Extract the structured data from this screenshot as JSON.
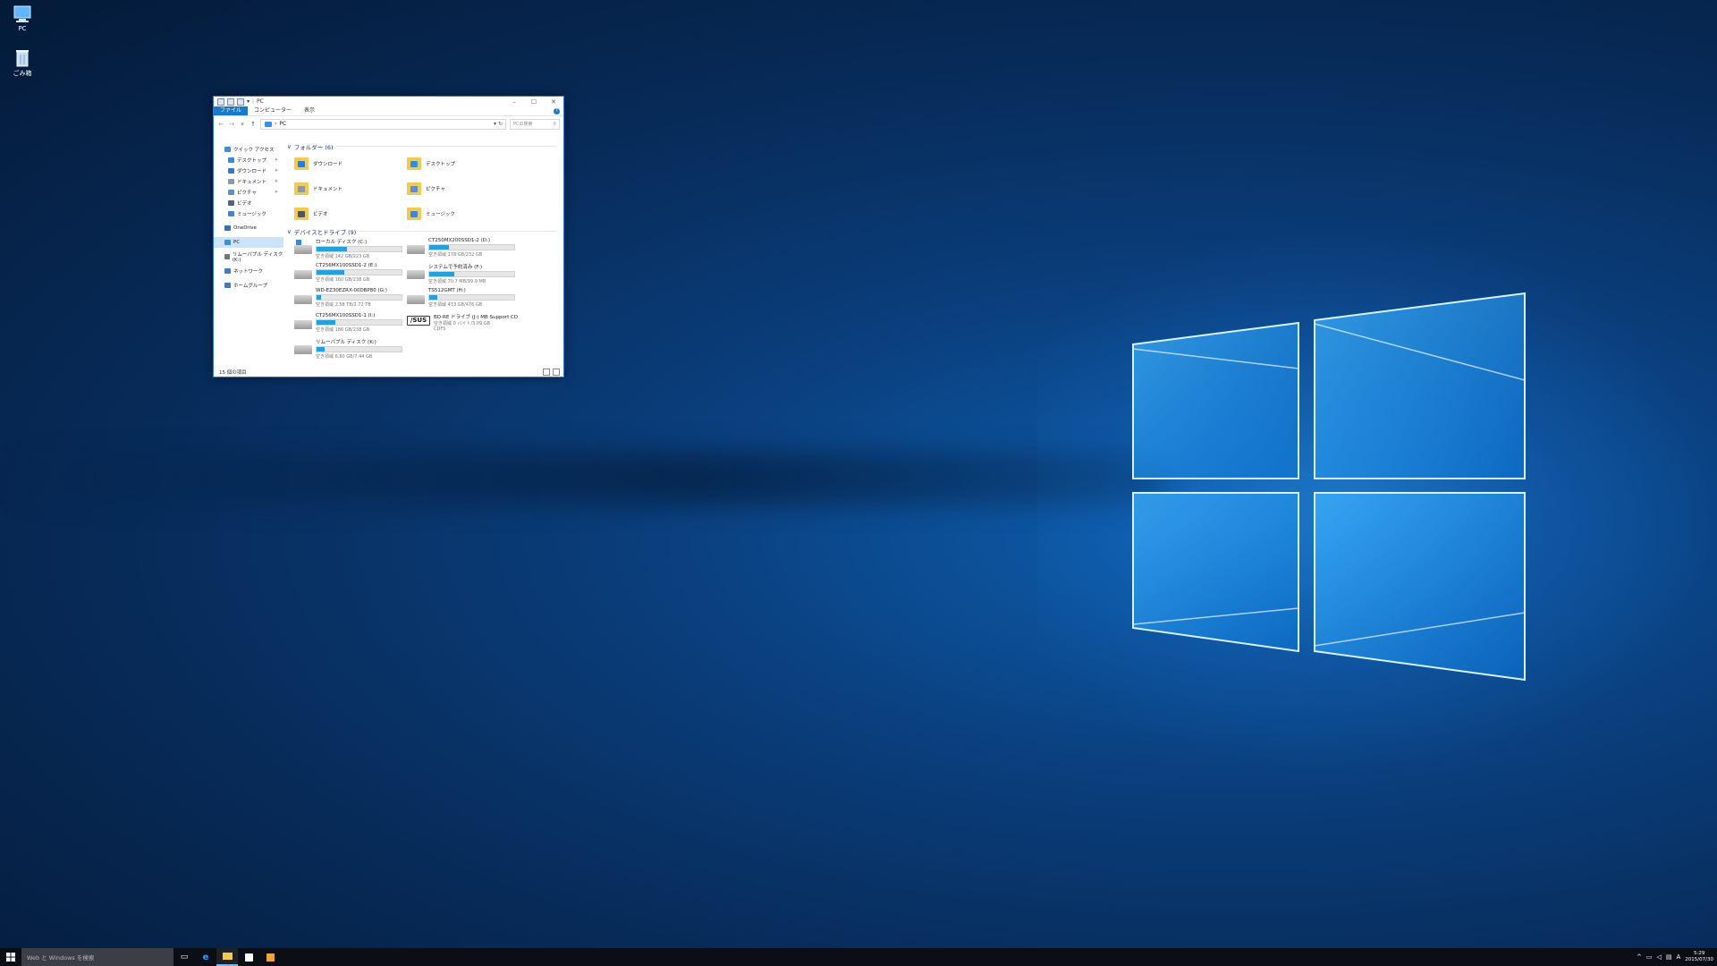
{
  "desktop": {
    "icons": [
      {
        "label": "PC"
      },
      {
        "label": "ごみ箱"
      }
    ]
  },
  "window": {
    "title": "PC",
    "ribbon_tabs": [
      "ファイル",
      "コンピューター",
      "表示"
    ],
    "address": "PC",
    "search_placeholder": "PCの検索",
    "nav": [
      {
        "label": "クイック アクセス",
        "pinned": false,
        "level": 0,
        "color": "#3a8ee6"
      },
      {
        "label": "デスクトップ",
        "pinned": true,
        "level": 1,
        "color": "#2f8fde"
      },
      {
        "label": "ダウンロード",
        "pinned": true,
        "level": 1,
        "color": "#2c7cd2"
      },
      {
        "label": "ドキュメント",
        "pinned": true,
        "level": 1,
        "color": "#8a9aa8"
      },
      {
        "label": "ピクチャ",
        "pinned": true,
        "level": 1,
        "color": "#5d8fc9"
      },
      {
        "label": "ビデオ",
        "pinned": false,
        "level": 1,
        "color": "#5a6470"
      },
      {
        "label": "ミュージック",
        "pinned": false,
        "level": 1,
        "color": "#3e86d6"
      },
      {
        "label": "OneDrive",
        "pinned": false,
        "level": 0,
        "color": "#2a73c9"
      },
      {
        "label": "PC",
        "pinned": false,
        "level": 0,
        "color": "#3c8ede",
        "selected": true
      },
      {
        "label": "リムーバブル ディスク (K:)",
        "pinned": false,
        "level": 0,
        "color": "#777777"
      },
      {
        "label": "ネットワーク",
        "pinned": false,
        "level": 0,
        "color": "#3c7fcf"
      },
      {
        "label": "ホームグループ",
        "pinned": false,
        "level": 0,
        "color": "#3f7ac2"
      }
    ],
    "folders_header": "フォルダー (6)",
    "folders": [
      {
        "label": "ダウンロード",
        "badge": "#2c7cd2"
      },
      {
        "label": "デスクトップ",
        "badge": "#2f8fde"
      },
      {
        "label": "ドキュメント",
        "badge": "#8a9aa8"
      },
      {
        "label": "ピクチャ",
        "badge": "#5d8fc9"
      },
      {
        "label": "ビデオ",
        "badge": "#4c5560"
      },
      {
        "label": "ミュージック",
        "badge": "#3e86d6"
      }
    ],
    "drives_header": "デバイスとドライブ (9)",
    "drives": [
      {
        "name": "ローカル ディスク (C:)",
        "free": "空き領域 142 GB/223 GB",
        "used": 0.36,
        "type": "win"
      },
      {
        "name": "CT250MX200SSD1-2 (D:)",
        "free": "空き領域 178 GB/232 GB",
        "used": 0.23,
        "type": "hdd"
      },
      {
        "name": "CT256MX100SSD1-2 (E:)",
        "free": "空き領域 160 GB/238 GB",
        "used": 0.33,
        "type": "hdd"
      },
      {
        "name": "システムで予約済み (F:)",
        "free": "空き領域 70.7 MB/99.9 MB",
        "used": 0.29,
        "type": "hdd"
      },
      {
        "name": "WD-EZ30EZRX-00DBP80 (G:)",
        "free": "空き領域 2.58 TB/2.72 TB",
        "used": 0.05,
        "type": "hdd"
      },
      {
        "name": "TS512GMT (H:)",
        "free": "空き領域 433 GB/476 GB",
        "used": 0.09,
        "type": "hdd"
      },
      {
        "name": "CT256MX100SSD1-1 (I:)",
        "free": "空き領域 186 GB/238 GB",
        "used": 0.22,
        "type": "hdd"
      },
      {
        "name": "BD-RE ドライブ (J:) MB Support CD",
        "free": "空き領域 0 バイト/3.09 GB",
        "sub": "CDFS",
        "used": null,
        "type": "asus"
      },
      {
        "name": "リムーバブル ディスク (K:)",
        "free": "空き領域 6.80 GB/7.44 GB",
        "used": 0.09,
        "type": "hdd"
      }
    ],
    "status": "15 個の項目"
  },
  "taskbar": {
    "search_placeholder": "Web と Windows を検索",
    "time": "5:29",
    "date": "2015/07/30",
    "ime": "A"
  }
}
